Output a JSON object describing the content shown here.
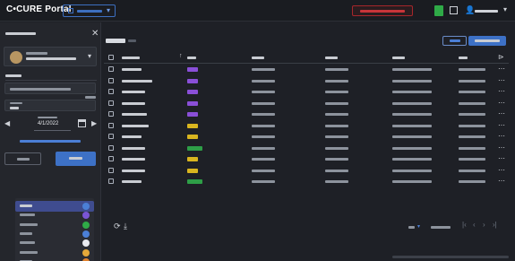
{
  "header": {
    "logo_text": "C•CURE Portal",
    "colors": {
      "nav_accent": "#3d6fc0",
      "alert": "#c8353a",
      "status_ok": "#2faa47"
    }
  },
  "left_panel": {
    "icons": [
      "close-icon",
      "chevron-down-icon",
      "chevron-left-icon",
      "chevron-right-icon",
      "calendar-icon"
    ],
    "date_value": "4/1/2022",
    "buttons": {
      "clear": "",
      "apply": ""
    },
    "stat_rows": [
      {
        "selected": true,
        "dot_color": "#4b7fd6"
      },
      {
        "selected": false,
        "dot_color": "#7a55d6"
      },
      {
        "selected": false,
        "dot_color": "#2faa47"
      },
      {
        "selected": false,
        "dot_color": "#4b7fd6"
      },
      {
        "selected": false,
        "dot_color": "#e8eaef"
      },
      {
        "selected": false,
        "dot_color": "#e4a83a"
      },
      {
        "selected": false,
        "dot_color": "#e0812d"
      }
    ]
  },
  "main": {
    "title": "Visitors",
    "icons": [
      "refresh-icon",
      "download-icon",
      "filter-icon"
    ],
    "status_colors": {
      "purple": "#8a4fd8",
      "yellow": "#d9b51f",
      "green": "#2e9e47"
    },
    "rows": [
      {
        "status_color": "#8a4fd8"
      },
      {
        "status_color": "#8a4fd8"
      },
      {
        "status_color": "#8a4fd8"
      },
      {
        "status_color": "#8a4fd8"
      },
      {
        "status_color": "#8a4fd8"
      },
      {
        "status_color": "#d9b51f"
      },
      {
        "status_color": "#d9b51f"
      },
      {
        "status_color": "#2e9e47"
      },
      {
        "status_color": "#d9b51f"
      },
      {
        "status_color": "#d9b51f"
      },
      {
        "status_color": "#2e9e47"
      }
    ]
  }
}
